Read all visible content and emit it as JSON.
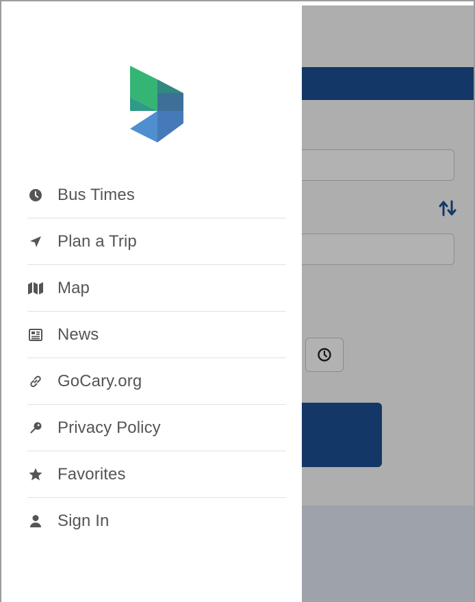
{
  "drawer": {
    "items": [
      {
        "label": "Bus Times",
        "icon": "clock-icon"
      },
      {
        "label": "Plan a Trip",
        "icon": "location-arrow-icon"
      },
      {
        "label": "Map",
        "icon": "map-icon"
      },
      {
        "label": "News",
        "icon": "newspaper-icon"
      },
      {
        "label": "GoCary.org",
        "icon": "link-icon"
      },
      {
        "label": "Privacy Policy",
        "icon": "key-icon"
      },
      {
        "label": "Favorites",
        "icon": "star-icon"
      },
      {
        "label": "Sign In",
        "icon": "user-icon"
      }
    ]
  },
  "background": {
    "swap_icon": "swap-vertical-icon",
    "time_icon": "clock-icon"
  },
  "colors": {
    "primary": "#1c4f93",
    "menu_text": "#555555",
    "menu_icon": "#555555",
    "logo_green": "#2ea86a",
    "logo_teal": "#3a8e8a",
    "logo_blue": "#3f7dc4",
    "logo_navy": "#3f5b83"
  }
}
